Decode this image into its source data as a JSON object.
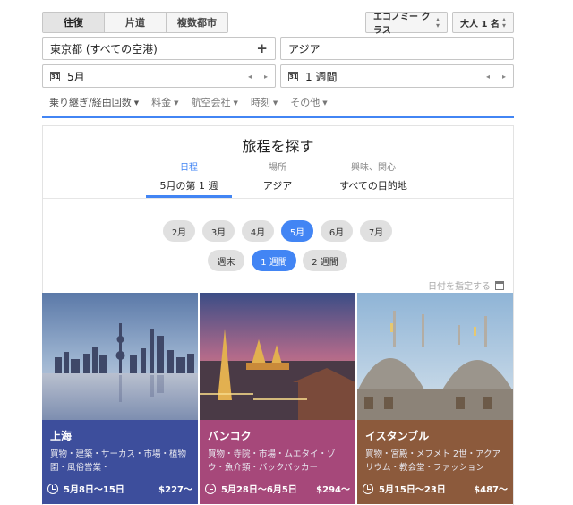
{
  "search": {
    "trip_types": [
      "往復",
      "片道",
      "複数都市"
    ],
    "cabin_class": "エコノミー クラス",
    "passengers": "大人 1 名",
    "origin": "東京都 (すべての空港)",
    "origin_add": "+",
    "destination": "アジア",
    "date": "5月",
    "duration": "1 週間",
    "calendar_glyph": "31",
    "prev_arrow": "◂",
    "next_arrow": "▸",
    "filters": [
      "乗り継ぎ/経由回数",
      "料金",
      "航空会社",
      "時刻",
      "その他"
    ]
  },
  "explore": {
    "title": "旅程を探す",
    "tabs": [
      {
        "label": "日程",
        "value": "5月の第 1 週"
      },
      {
        "label": "場所",
        "value": "アジア"
      },
      {
        "label": "興味、関心",
        "value": "すべての目的地"
      }
    ],
    "months": [
      "2月",
      "3月",
      "4月",
      "5月",
      "6月",
      "7月"
    ],
    "selected_month": "5月",
    "durations": [
      "週末",
      "1 週間",
      "2 週間"
    ],
    "selected_duration": "1 週間",
    "pick_date": "日付を指定する",
    "accent_color": "#4285f4"
  },
  "destinations": [
    {
      "city": "上海",
      "tags": "買物・建築・サーカス・市場・植物園・風俗営業・",
      "dates": "5月8日〜15日",
      "price": "$227〜",
      "color": "#3d4e9c"
    },
    {
      "city": "バンコク",
      "tags": "買物・寺院・市場・ムエタイ・ゾウ・魚介類・バックパッカー",
      "dates": "5月28日〜6月5日",
      "price": "$294〜",
      "color": "#a6487a"
    },
    {
      "city": "イスタンブル",
      "tags": "買物・宮殿・メフメト 2世・アクアリウム・教会堂・ファッション",
      "dates": "5月15日〜23日",
      "price": "$487〜",
      "color": "#8c5a3c"
    }
  ]
}
